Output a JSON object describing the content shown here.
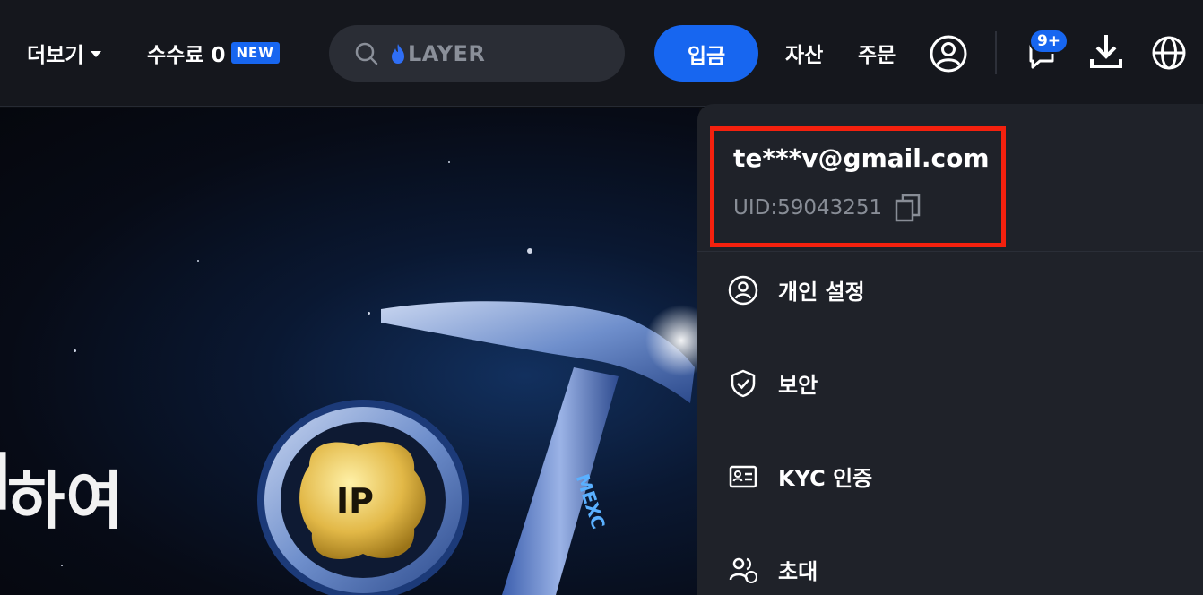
{
  "header": {
    "more_label": "더보기",
    "fee_label": "수수료 0",
    "fee_badge": "NEW",
    "search_placeholder": "LAYER",
    "deposit_label": "입금",
    "assets_label": "자산",
    "orders_label": "주문",
    "notification_count": "9+"
  },
  "hero": {
    "headline_fragment": "하여",
    "coin_label": "IP",
    "pickaxe_brand": "MEXC"
  },
  "account_menu": {
    "email": "te***v@gmail.com",
    "uid": "UID:59043251",
    "items": [
      {
        "label": "개인 설정",
        "icon": "user-circle-icon"
      },
      {
        "label": "보안",
        "icon": "shield-check-icon"
      },
      {
        "label": "KYC 인증",
        "icon": "id-card-icon"
      },
      {
        "label": "초대",
        "icon": "users-invite-icon"
      }
    ]
  },
  "colors": {
    "accent": "#1766f0",
    "highlight_border": "#f4210e",
    "header_bg": "#15171d",
    "menu_bg": "#1f2229"
  }
}
